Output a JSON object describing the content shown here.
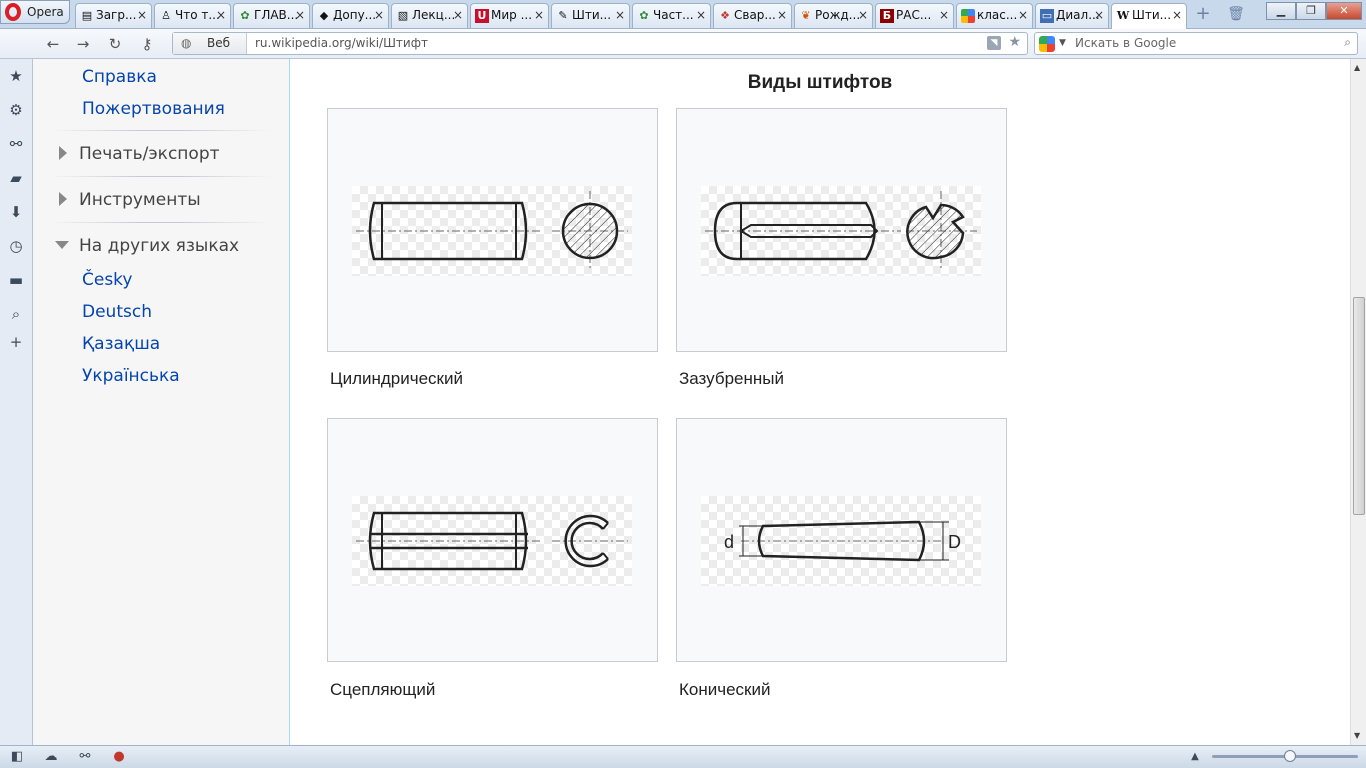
{
  "browser": {
    "menu_label": "Opera",
    "tabs": [
      {
        "label": "Загр...",
        "icon": "doc-icon"
      },
      {
        "label": "Что т...",
        "icon": "person-icon"
      },
      {
        "label": "ГЛАВ...",
        "icon": "gear-icon"
      },
      {
        "label": "Допу...",
        "icon": "diamond-icon"
      },
      {
        "label": "Лекц...",
        "icon": "page-icon"
      },
      {
        "label": "Мир ...",
        "icon": "u-logo-icon"
      },
      {
        "label": "Шти...",
        "icon": "pencil-icon"
      },
      {
        "label": "Част...",
        "icon": "gear-icon"
      },
      {
        "label": "Свар...",
        "icon": "gift-icon"
      },
      {
        "label": "Рожд...",
        "icon": "balloon-icon"
      },
      {
        "label": "РАС...",
        "icon": "b-logo-icon"
      },
      {
        "label": "клас...",
        "icon": "google-icon"
      },
      {
        "label": "Диал...",
        "icon": "chat-icon"
      },
      {
        "label": "Шти...",
        "icon": "wikipedia-icon"
      }
    ],
    "address_prefix": "Веб",
    "url": "ru.wikipedia.org/wiki/Штифт",
    "search_placeholder": "Искать в Google"
  },
  "sidebar": {
    "links_top": [
      "Справка",
      "Пожертвования"
    ],
    "sections": [
      "Печать/экспорт",
      "Инструменты",
      "На других языках"
    ],
    "languages": [
      "Česky",
      "Deutsch",
      "Қазақша",
      "Українська"
    ]
  },
  "gallery": {
    "title": "Виды штифтов",
    "items": [
      {
        "caption": "Цилиндрический",
        "image": "cylindrical-pin-drawing"
      },
      {
        "caption": "Зазубренный",
        "image": "grooved-pin-drawing"
      },
      {
        "caption": "Сцепляющий",
        "image": "spring-pin-drawing"
      },
      {
        "caption": "Конический",
        "image": "taper-pin-drawing",
        "dim_small": "d",
        "dim_large": "D"
      }
    ]
  },
  "colors": {
    "link": "#0645ad",
    "tab_bar": "#c9d9ec",
    "sidebar_bg": "#f6f6f6"
  }
}
